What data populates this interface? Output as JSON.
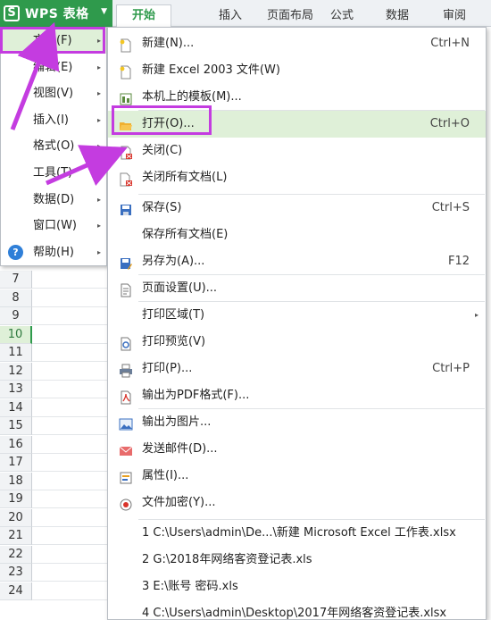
{
  "app": {
    "title": "WPS 表格",
    "logo_letter": "S"
  },
  "tabs": [
    "开始",
    "插入",
    "页面布局",
    "公式",
    "数据",
    "审阅"
  ],
  "rows": [
    "7",
    "8",
    "9",
    "10",
    "11",
    "12",
    "13",
    "14",
    "15",
    "16",
    "17",
    "18",
    "19",
    "20",
    "21",
    "22",
    "23",
    "24"
  ],
  "active_row": "10",
  "left_menu": [
    {
      "label": "文件(F)",
      "arrow": "▸"
    },
    {
      "label": "编辑(E)",
      "arrow": "▸"
    },
    {
      "label": "视图(V)",
      "arrow": "▸"
    },
    {
      "label": "插入(I)",
      "arrow": "▸"
    },
    {
      "label": "格式(O)",
      "arrow": "▸"
    },
    {
      "label": "工具(T)",
      "arrow": "▸"
    },
    {
      "label": "数据(D)",
      "arrow": "▸"
    },
    {
      "label": "窗口(W)",
      "arrow": "▸"
    },
    {
      "label": "帮助(H)",
      "arrow": "▸"
    }
  ],
  "file_menu": [
    {
      "label": "新建(N)...",
      "shortcut": "Ctrl+N",
      "icon": "new-file-icon"
    },
    {
      "label": "新建 Excel 2003 文件(W)",
      "shortcut": "",
      "icon": "new-excel-icon"
    },
    {
      "label": "本机上的模板(M)...",
      "shortcut": "",
      "icon": "template-icon"
    },
    {
      "label": "打开(O)...",
      "shortcut": "Ctrl+O",
      "icon": "open-folder-icon"
    },
    {
      "label": "关闭(C)",
      "shortcut": "",
      "icon": "close-doc-icon"
    },
    {
      "label": "关闭所有文档(L)",
      "shortcut": "",
      "icon": "close-all-icon"
    },
    {
      "label": "保存(S)",
      "shortcut": "Ctrl+S",
      "icon": "save-icon"
    },
    {
      "label": "保存所有文档(E)",
      "shortcut": "",
      "icon": ""
    },
    {
      "label": "另存为(A)...",
      "shortcut": "F12",
      "icon": "save-as-icon"
    },
    {
      "label": "页面设置(U)...",
      "shortcut": "",
      "icon": "page-setup-icon"
    },
    {
      "label": "打印区域(T)",
      "shortcut": "",
      "icon": "",
      "submenu": "▸"
    },
    {
      "label": "打印预览(V)",
      "shortcut": "",
      "icon": "print-preview-icon"
    },
    {
      "label": "打印(P)...",
      "shortcut": "Ctrl+P",
      "icon": "print-icon"
    },
    {
      "label": "输出为PDF格式(F)...",
      "shortcut": "",
      "icon": "pdf-icon"
    },
    {
      "label": "输出为图片...",
      "shortcut": "",
      "icon": "image-export-icon"
    },
    {
      "label": "发送邮件(D)...",
      "shortcut": "",
      "icon": "mail-icon"
    },
    {
      "label": "属性(I)...",
      "shortcut": "",
      "icon": "properties-icon"
    },
    {
      "label": "文件加密(Y)...",
      "shortcut": "",
      "icon": "encrypt-icon"
    },
    {
      "label": "1 C:\\Users\\admin\\De...\\新建 Microsoft Excel 工作表.xlsx",
      "shortcut": "",
      "icon": ""
    },
    {
      "label": "2 G:\\2018年网络客资登记表.xls",
      "shortcut": "",
      "icon": ""
    },
    {
      "label": "3 E:\\账号 密码.xls",
      "shortcut": "",
      "icon": ""
    },
    {
      "label": "4 C:\\Users\\admin\\Desktop\\2017年网络客资登记表.xlsx",
      "shortcut": "",
      "icon": ""
    }
  ],
  "colors": {
    "accent": "#2f9a4c",
    "highlight": "#dff0d8",
    "annotation": "#c43ce0"
  }
}
